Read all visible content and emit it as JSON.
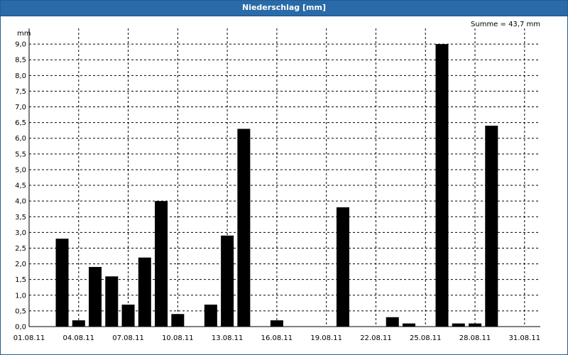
{
  "window": {
    "title": "Niederschlag [mm]",
    "title_bar_color": "#2a6aa8"
  },
  "chart_data": {
    "type": "bar",
    "title": "Niederschlag [mm]",
    "ylabel": "mm",
    "xlabel": "",
    "summary": "Summe = 43,7 mm",
    "bar_color": "#000000",
    "grid": true,
    "grid_style": "dashed",
    "ylim": [
      0,
      9.5
    ],
    "y_ticks": [
      "0,0",
      "0,5",
      "1,0",
      "1,5",
      "2,0",
      "2,5",
      "3,0",
      "3,5",
      "4,0",
      "4,5",
      "5,0",
      "5,5",
      "6,0",
      "6,5",
      "7,0",
      "7,5",
      "8,0",
      "8,5",
      "9,0"
    ],
    "x_tick_labels": [
      "01.08.11",
      "04.08.11",
      "07.08.11",
      "10.08.11",
      "13.08.11",
      "16.08.11",
      "19.08.11",
      "22.08.11",
      "25.08.11",
      "28.08.11",
      "31.08.11"
    ],
    "categories": [
      "01.08.11",
      "02.08.11",
      "03.08.11",
      "04.08.11",
      "05.08.11",
      "06.08.11",
      "07.08.11",
      "08.08.11",
      "09.08.11",
      "10.08.11",
      "11.08.11",
      "12.08.11",
      "13.08.11",
      "14.08.11",
      "15.08.11",
      "16.08.11",
      "17.08.11",
      "18.08.11",
      "19.08.11",
      "20.08.11",
      "21.08.11",
      "22.08.11",
      "23.08.11",
      "24.08.11",
      "25.08.11",
      "26.08.11",
      "27.08.11",
      "28.08.11",
      "29.08.11",
      "30.08.11",
      "31.08.11"
    ],
    "values": [
      0,
      0,
      2.8,
      0.2,
      1.9,
      1.6,
      0.7,
      2.2,
      4.0,
      0.4,
      0,
      0.7,
      2.9,
      6.3,
      0,
      0.2,
      0,
      0,
      0,
      3.8,
      0,
      0,
      0.3,
      0.1,
      0,
      9.0,
      0.1,
      0.1,
      6.4,
      0,
      0
    ]
  }
}
